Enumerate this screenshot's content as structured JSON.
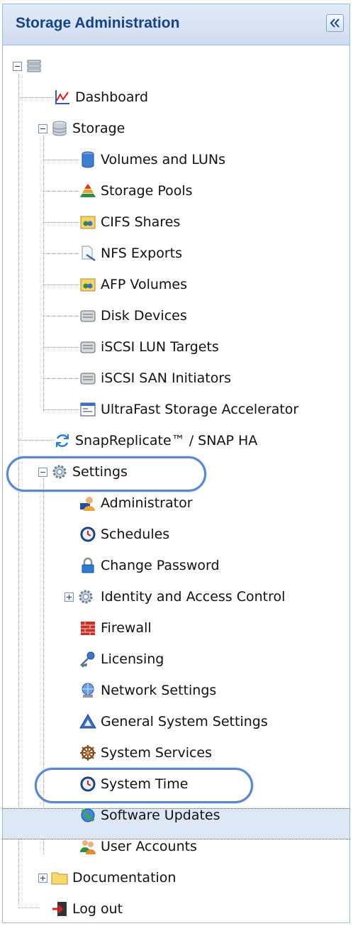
{
  "panel": {
    "title": "Storage Administration"
  },
  "tree": {
    "root_icon": "server-rack-icon",
    "items": [
      {
        "label": "Dashboard",
        "icon": "line-chart-icon"
      },
      {
        "label": "Storage",
        "icon": "database-icon",
        "expanded": true,
        "children": [
          {
            "label": "Volumes and LUNs",
            "icon": "cylinder-icon"
          },
          {
            "label": "Storage Pools",
            "icon": "pyramid-icon"
          },
          {
            "label": "CIFS Shares",
            "icon": "share-folder-icon"
          },
          {
            "label": "NFS Exports",
            "icon": "document-export-icon"
          },
          {
            "label": "AFP Volumes",
            "icon": "share-folder-icon"
          },
          {
            "label": "Disk Devices",
            "icon": "disk-icon"
          },
          {
            "label": "iSCSI LUN Targets",
            "icon": "disk-icon"
          },
          {
            "label": "iSCSI SAN Initiators",
            "icon": "disk-icon"
          },
          {
            "label": "UltraFast Storage Accelerator",
            "icon": "accelerator-icon"
          }
        ]
      },
      {
        "label": "SnapReplicate™ / SNAP HA",
        "icon": "replicate-icon"
      },
      {
        "label": "Settings",
        "icon": "gear-icon",
        "expanded": true,
        "children": [
          {
            "label": "Administrator",
            "icon": "admin-user-icon"
          },
          {
            "label": "Schedules",
            "icon": "clock-icon"
          },
          {
            "label": "Change Password",
            "icon": "lock-icon"
          },
          {
            "label": "Identity and Access Control",
            "icon": "gear-icon",
            "collapsed": true
          },
          {
            "label": "Firewall",
            "icon": "firewall-icon"
          },
          {
            "label": "Licensing",
            "icon": "key-icon"
          },
          {
            "label": "Network Settings",
            "icon": "network-icon"
          },
          {
            "label": "General System Settings",
            "icon": "system-settings-icon"
          },
          {
            "label": "System Services",
            "icon": "wheel-icon"
          },
          {
            "label": "System Time",
            "icon": "clock-icon",
            "selected": true
          },
          {
            "label": "Software Updates",
            "icon": "globe-update-icon"
          },
          {
            "label": "User Accounts",
            "icon": "users-icon"
          }
        ]
      },
      {
        "label": "Documentation",
        "icon": "folder-icon",
        "collapsed": true
      },
      {
        "label": "Log out",
        "icon": "logout-icon"
      }
    ]
  },
  "colors": {
    "header_text": "#15428b",
    "panel_border": "#99bbe8",
    "selection_bg": "#dfe8f6",
    "annotation_ring": "#5b86c8"
  }
}
